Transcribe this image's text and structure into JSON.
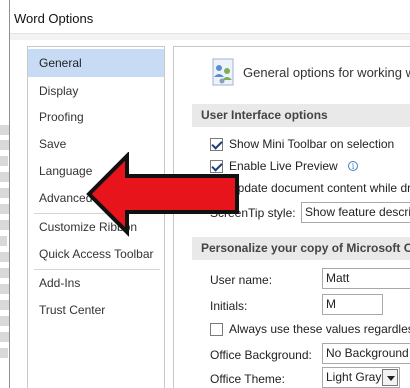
{
  "window": {
    "title": "Word Options"
  },
  "nav": {
    "items": [
      {
        "label": "General",
        "selected": true
      },
      {
        "label": "Display"
      },
      {
        "label": "Proofing"
      },
      {
        "label": "Save"
      },
      {
        "label": "Language"
      },
      {
        "label": "Advanced"
      },
      {
        "label": "Customize Ribbon"
      },
      {
        "label": "Quick Access Toolbar"
      },
      {
        "label": "Add-Ins"
      },
      {
        "label": "Trust Center"
      }
    ]
  },
  "content": {
    "header": "General options for working w",
    "ui_section": {
      "title": "User Interface options",
      "mini_toolbar": {
        "label": "Show Mini Toolbar on selection",
        "checked": true
      },
      "live_preview": {
        "label": "Enable Live Preview",
        "checked": true
      },
      "update_content": {
        "label": "Update document content while dra"
      },
      "screentip": {
        "label": "ScreenTip style:",
        "value": "Show feature descript"
      }
    },
    "personalize_section": {
      "title": "Personalize your copy of Microsoft Offic",
      "user_name": {
        "label": "User name:",
        "value": "Matt"
      },
      "initials": {
        "label": "Initials:",
        "value": "M"
      },
      "always_use": {
        "label": "Always use these values regardless o",
        "checked": false
      },
      "office_background": {
        "label": "Office Background:",
        "value": "No Background"
      },
      "office_theme": {
        "label": "Office Theme:",
        "value": "Light Gray"
      }
    }
  },
  "colors": {
    "selected_nav": "#c7dcf4",
    "arrow_fill": "#e8141b",
    "section_bar": "#e9e9e9"
  },
  "icons": {
    "header_icon": "people-settings-icon",
    "info_icon": "info-icon",
    "annotation": "red-arrow-pointing-left"
  }
}
